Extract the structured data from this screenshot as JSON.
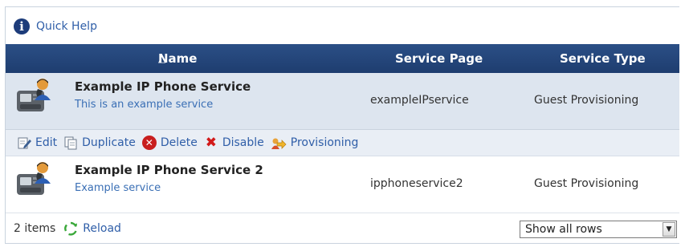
{
  "quick_help": {
    "label": "Quick Help",
    "icon": "info-icon"
  },
  "table": {
    "columns": {
      "name": "Name",
      "sort_arrow": "△",
      "page": "Service Page",
      "type": "Service Type"
    },
    "rows": [
      {
        "name": "Example IP Phone Service",
        "description": "This is an example service",
        "page": "exampleIPservice",
        "type": "Guest Provisioning",
        "icon": "ip-phone-user-icon",
        "selected": true
      },
      {
        "name": "Example IP Phone Service 2",
        "description": "Example service",
        "page": "ipphoneservice2",
        "type": "Guest Provisioning",
        "icon": "ip-phone-user-icon",
        "selected": false
      }
    ]
  },
  "actions": {
    "edit": "Edit",
    "duplicate": "Duplicate",
    "delete": "Delete",
    "disable": "Disable",
    "provisioning": "Provisioning"
  },
  "footer": {
    "count": "2 items",
    "reload": "Reload",
    "rows_select": {
      "selected": "Show all rows"
    }
  },
  "colors": {
    "header_bg": "#1e3d6f",
    "selected_row_bg": "#dde5ef",
    "link": "#2f5ea8",
    "delete_red": "#c81e1e"
  }
}
